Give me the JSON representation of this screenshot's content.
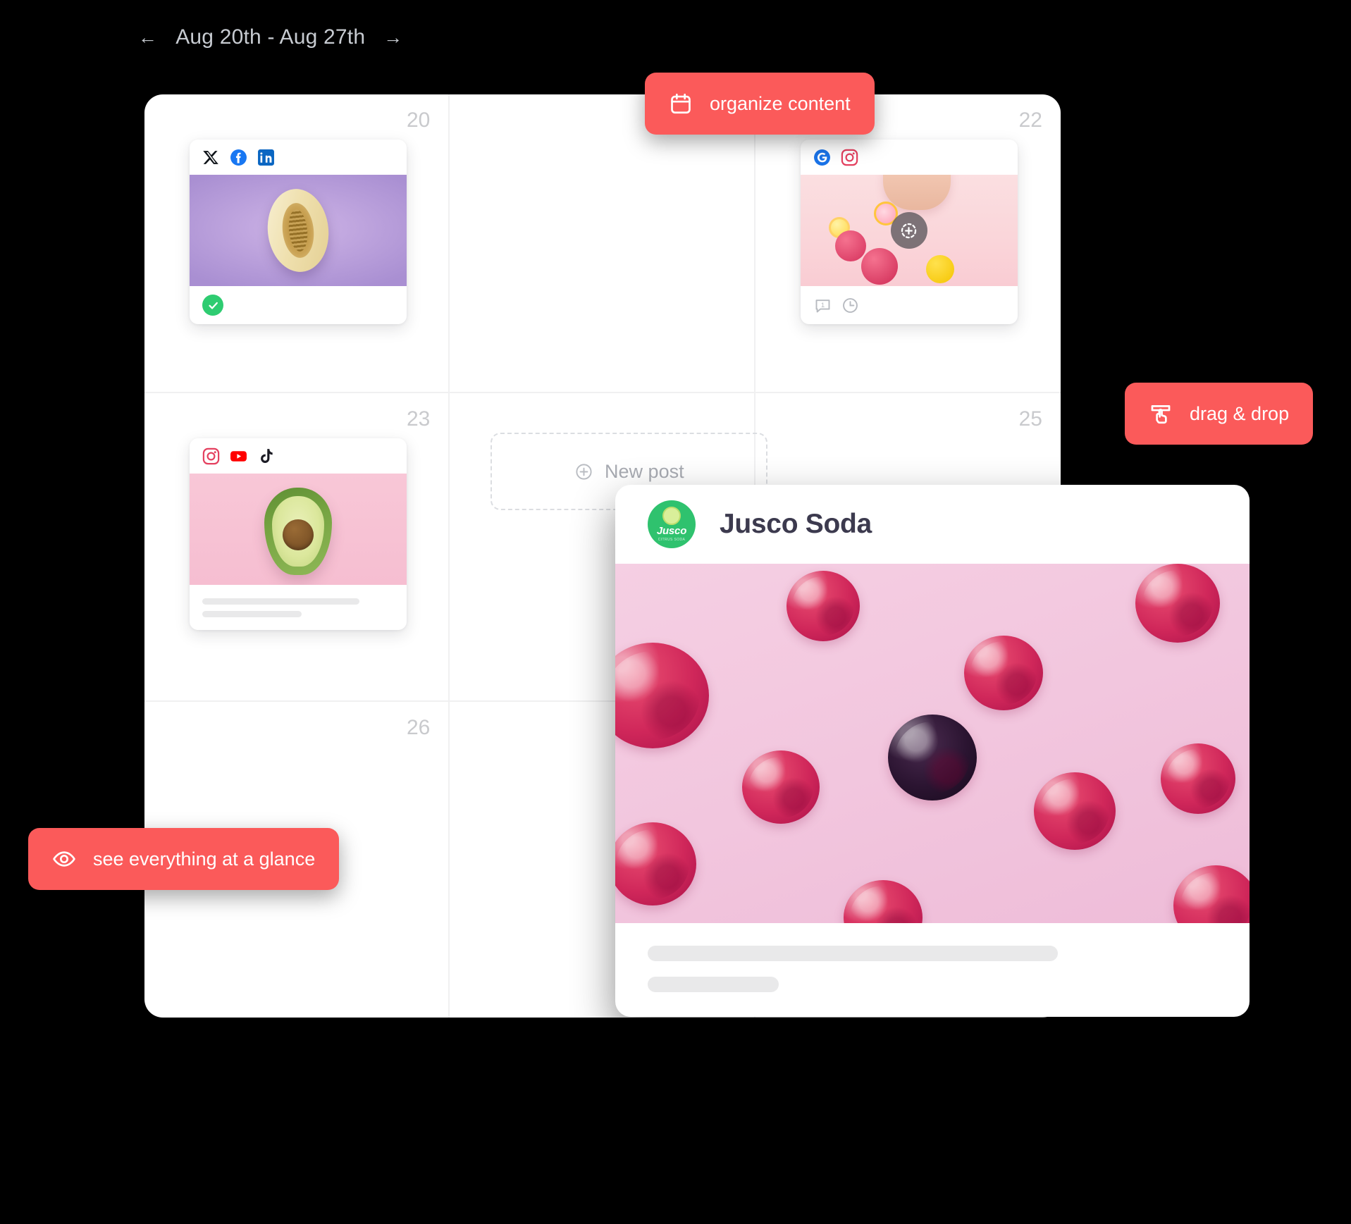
{
  "header": {
    "prev_arrow": "←",
    "date_range": "Aug 20th - Aug 27th",
    "next_arrow": "→"
  },
  "calendar": {
    "cells": [
      {
        "day": "20",
        "content": "post"
      },
      {
        "day": "",
        "content": "empty"
      },
      {
        "day": "22",
        "content": "post"
      },
      {
        "day": "23",
        "content": "post"
      },
      {
        "day": "",
        "content": "new-post"
      },
      {
        "day": "25",
        "content": "empty"
      },
      {
        "day": "26",
        "content": "empty"
      },
      {
        "day": "",
        "content": "empty"
      },
      {
        "day": "",
        "content": "empty"
      }
    ],
    "new_post_label": "New post"
  },
  "posts": [
    {
      "id": "post-melon",
      "day": "20",
      "networks": [
        "x-icon",
        "facebook-icon",
        "linkedin-icon"
      ],
      "status": "published",
      "status_icon": "check-circle-icon",
      "image_alt": "sliced melon on purple background"
    },
    {
      "id": "post-citrus",
      "day": "22",
      "networks": [
        "google-business-icon",
        "instagram-icon"
      ],
      "footer_icons": [
        "comment-icon",
        "clock-icon"
      ],
      "comment_count": "1",
      "overlay_icon": "add-carousel-icon",
      "image_alt": "hand dropping citrus and berries on pink background"
    },
    {
      "id": "post-avocado",
      "day": "23",
      "networks": [
        "instagram-icon",
        "youtube-icon",
        "tiktok-icon"
      ],
      "image_alt": "halved avocado on pink background"
    }
  ],
  "badges": [
    {
      "id": "organize",
      "icon": "calendar-icon",
      "label": "organize content"
    },
    {
      "id": "drag",
      "icon": "drag-drop-icon",
      "label": "drag & drop"
    },
    {
      "id": "glance",
      "icon": "eye-icon",
      "label": "see everything at a glance"
    }
  ],
  "preview": {
    "avatar_brand": "Jusco",
    "avatar_sub": "CITRUS SODA",
    "account_name": "Jusco Soda",
    "image_alt": "raspberries and one blackberry on pink background"
  },
  "colors": {
    "accent": "#fb5a5a",
    "background": "#000000",
    "panel": "#ffffff",
    "daynum": "#c9cacd",
    "status_green": "#2ecc71",
    "brand_green": "#2fc26e",
    "title_text": "#3c3a4e",
    "muted_text": "#a8abb2"
  }
}
